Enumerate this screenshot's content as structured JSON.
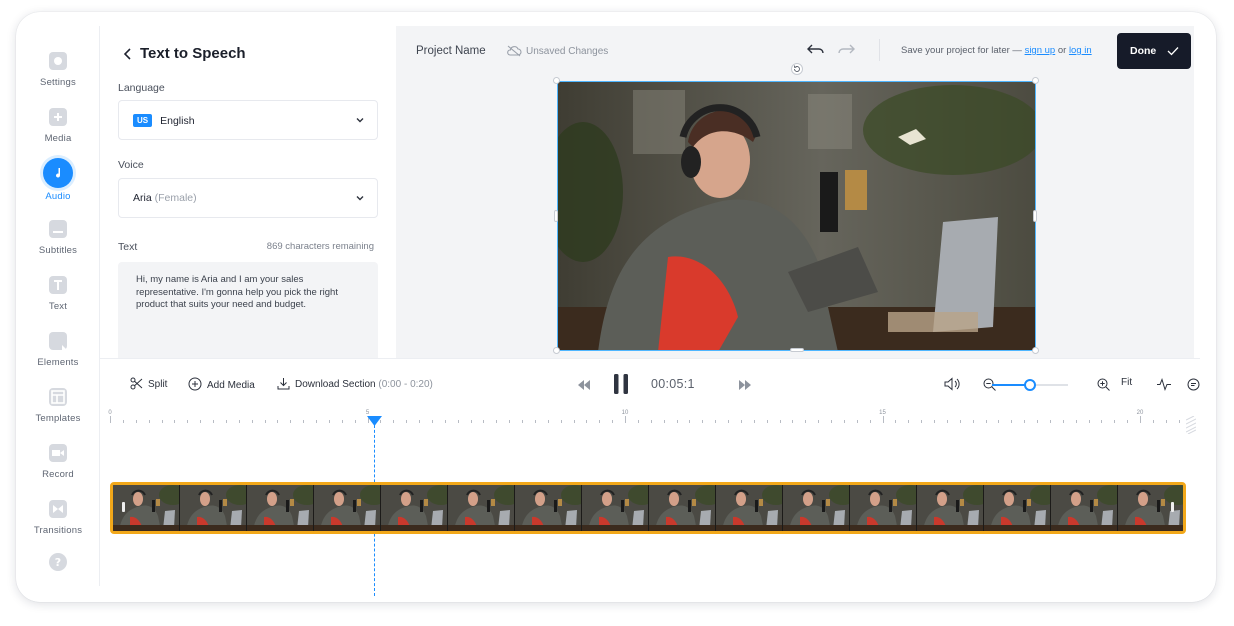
{
  "rail": {
    "items": [
      {
        "label": "Settings",
        "icon": "gear-icon"
      },
      {
        "label": "Media",
        "icon": "plus-icon"
      },
      {
        "label": "Audio",
        "icon": "music-note-icon",
        "active": true
      },
      {
        "label": "Subtitles",
        "icon": "subtitles-icon"
      },
      {
        "label": "Text",
        "icon": "text-icon"
      },
      {
        "label": "Elements",
        "icon": "elements-icon"
      },
      {
        "label": "Templates",
        "icon": "templates-icon"
      },
      {
        "label": "Record",
        "icon": "camera-icon"
      },
      {
        "label": "Transitions",
        "icon": "transitions-icon"
      }
    ],
    "help_icon": "help-icon"
  },
  "panel": {
    "title": "Text to Speech",
    "language_label": "Language",
    "language_flag": "US",
    "language_value": "English",
    "voice_label": "Voice",
    "voice_name": "Aria",
    "voice_gender": "(Female)",
    "text_label": "Text",
    "chars_remaining": "869 characters remaining",
    "text_value": "Hi, my name is Aria and I am your sales representative. I'm gonna help you pick the right product that suits your need and budget."
  },
  "header": {
    "project_name": "Project Name",
    "unsaved": "Unsaved Changes",
    "save_prompt": "Save your project for later —",
    "sign_up": "sign up",
    "or": "or",
    "log_in": "log in",
    "done_label": "Done"
  },
  "toolbar": {
    "split": "Split",
    "add_media": "Add Media",
    "download_section": "Download Section",
    "download_range": "(0:00 - 0:20)",
    "time": "00:05:1",
    "fit": "Fit",
    "zoom_level": 0.5
  },
  "timeline": {
    "tick_labels": [
      "0",
      "5",
      "10",
      "15",
      "20"
    ],
    "playhead_seconds": 5.1,
    "thumbnail_count": 16
  },
  "colors": {
    "accent": "#1a8cff",
    "done_bg": "#161b29",
    "strip_border": "#f2a81a"
  }
}
